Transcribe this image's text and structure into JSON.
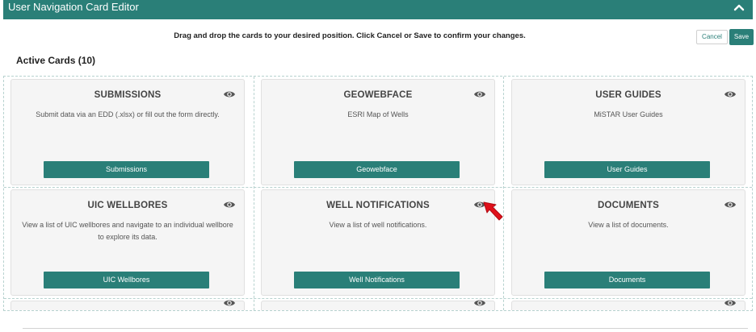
{
  "header": {
    "title": "User Navigation Card Editor"
  },
  "instructions": "Drag and drop the cards to your desired position. Click Cancel or Save to confirm your changes.",
  "actions": {
    "cancel_label": "Cancel",
    "save_label": "Save"
  },
  "section": {
    "title": "Active Cards (10)"
  },
  "cards": [
    {
      "title": "SUBMISSIONS",
      "description": "Submit data via an EDD (.xlsx) or fill out the form directly.",
      "button_label": "Submissions"
    },
    {
      "title": "GEOWEBFACE",
      "description": "ESRI Map of Wells",
      "button_label": "Geowebface"
    },
    {
      "title": "USER GUIDES",
      "description": "MiSTAR User Guides",
      "button_label": "User Guides"
    },
    {
      "title": "UIC WELLBORES",
      "description": "View a list of UIC wellbores and navigate to an individual wellbore to explore its data.",
      "button_label": "UIC Wellbores"
    },
    {
      "title": "WELL NOTIFICATIONS",
      "description": "View a list of well notifications.",
      "button_label": "Well Notifications"
    },
    {
      "title": "DOCUMENTS",
      "description": "View a list of documents.",
      "button_label": "Documents"
    }
  ],
  "colors": {
    "accent": "#2a7f78",
    "annotation": "#e0101a"
  }
}
